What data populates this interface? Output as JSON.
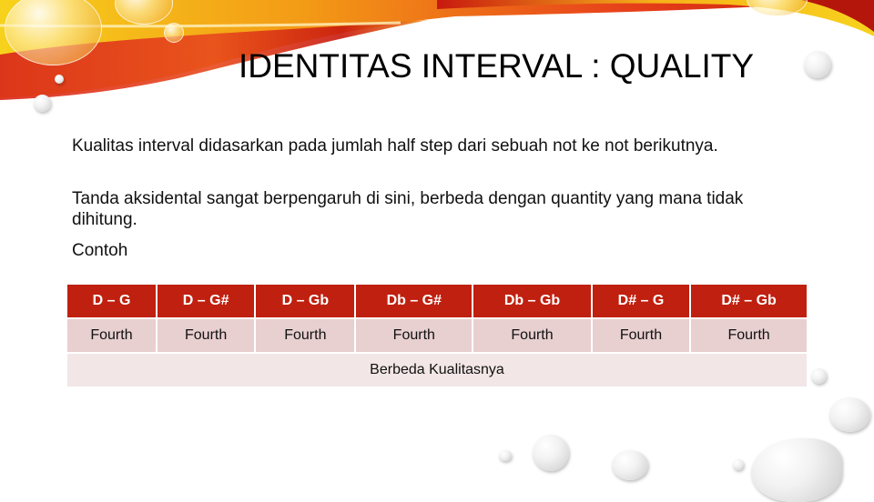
{
  "slide": {
    "title": "IDENTITAS INTERVAL : QUALITY",
    "paragraphs": [
      "Kualitas interval didasarkan pada jumlah half step dari sebuah not ke not berikutnya.",
      "Tanda aksidental sangat berpengaruh di sini, berbeda dengan quantity yang mana tidak dihitung.",
      "Contoh"
    ]
  },
  "table": {
    "intervals": [
      "D – G",
      "D – G#",
      "D – Gb",
      "Db – G#",
      "Db – Gb",
      "D# – G",
      "D# – Gb"
    ],
    "qualities": [
      "Fourth",
      "Fourth",
      "Fourth",
      "Fourth",
      "Fourth",
      "Fourth",
      "Fourth"
    ],
    "note": "Berbeda Kualitasnya"
  },
  "colors": {
    "header_bg": "#c0200f",
    "row_bg": "#e8cfd0",
    "note_bg": "#f3e6e6"
  }
}
